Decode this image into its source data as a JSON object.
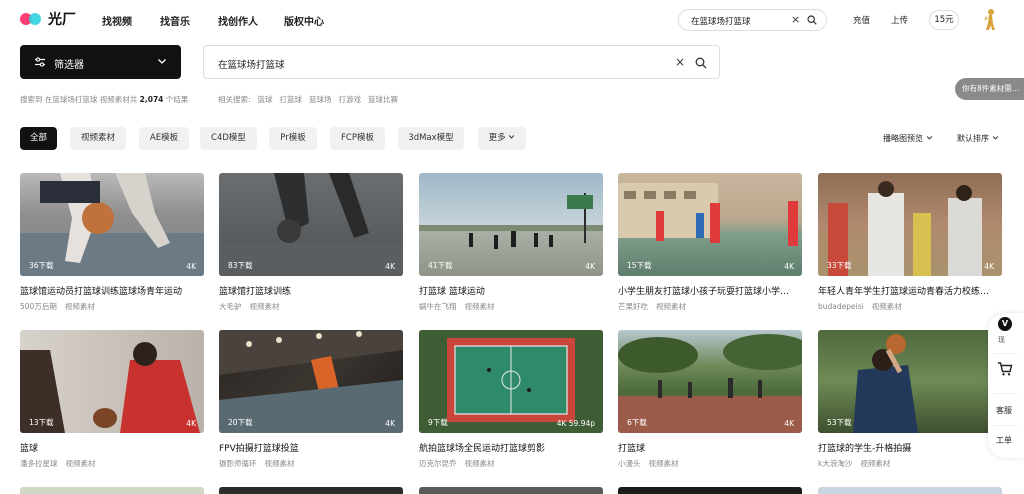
{
  "brand": {
    "name": "光厂"
  },
  "nav": {
    "links": [
      "找视频",
      "找音乐",
      "找创作人",
      "版权中心"
    ]
  },
  "top_search": {
    "value": "在篮球场打篮球"
  },
  "top_right": {
    "recharge": "充值",
    "upload": "上传",
    "coins": "15元"
  },
  "filter": {
    "label": "筛选器"
  },
  "main_search": {
    "value": "在篮球场打篮球"
  },
  "result": {
    "prefix": "搜索到 在篮球场打篮球 视频素材共",
    "count": "2,074",
    "suffix": "个结果"
  },
  "related": {
    "label": "相关搜索:",
    "items": [
      "篮球",
      "打篮球",
      "篮球场",
      "打游戏",
      "篮球比赛"
    ]
  },
  "notify": {
    "text": "你有8件素材需…"
  },
  "categories": [
    "全部",
    "视频素材",
    "AE模板",
    "C4D模型",
    "Pr模板",
    "FCP模板",
    "3dMax模型",
    "更多"
  ],
  "sort": {
    "preview": "播略图预览",
    "order": "默认排序"
  },
  "cards": [
    {
      "title": "篮球馆运动员打篮球训练篮球场青年运动",
      "author": "500万后期",
      "type": "视频素材",
      "downloads": "36下载",
      "quality": "4K"
    },
    {
      "title": "篮球馆打篮球训练",
      "author": "大毛驴",
      "type": "视频素材",
      "downloads": "83下载",
      "quality": "4K"
    },
    {
      "title": "打篮球 篮球运动",
      "author": "蜗牛在飞翔",
      "type": "视频素材",
      "downloads": "41下载",
      "quality": "4K"
    },
    {
      "title": "小学生朋友打篮球小孩子玩耍打篮球小学…",
      "author": "芒果好吃",
      "type": "视频素材",
      "downloads": "15下载",
      "quality": "4K"
    },
    {
      "title": "年轻人青年学生打篮球运动青春活力校练…",
      "author": "budadepeisi",
      "type": "视频素材",
      "downloads": "33下载",
      "quality": "4K"
    },
    {
      "title": "篮球",
      "author": "潘多拉星球",
      "type": "视频素材",
      "downloads": "13下载",
      "quality": "4K"
    },
    {
      "title": "FPV拍摄打篮球投篮",
      "author": "摄影师循环",
      "type": "视频素材",
      "downloads": "20下载",
      "quality": "4K"
    },
    {
      "title": "航拍篮球场全民运动打篮球剪影",
      "author": "迈克尔昆乔",
      "type": "视频素材",
      "downloads": "9下载",
      "quality": "4K 59.94p"
    },
    {
      "title": "打篮球",
      "author": "小漫头",
      "type": "视频素材",
      "downloads": "6下载",
      "quality": "4K"
    },
    {
      "title": "打篮球的学生-升格拍摄",
      "author": "k大浪淘沙",
      "type": "视频素材",
      "downloads": "53下载",
      "quality": "4"
    }
  ],
  "floatbar": {
    "vip": "V",
    "vip_text": "现",
    "service": "客服",
    "tools": "工单"
  },
  "colors": {
    "accent": "#111111",
    "brand_pink": "#ff3d6e",
    "brand_cyan": "#2fd3e0"
  }
}
